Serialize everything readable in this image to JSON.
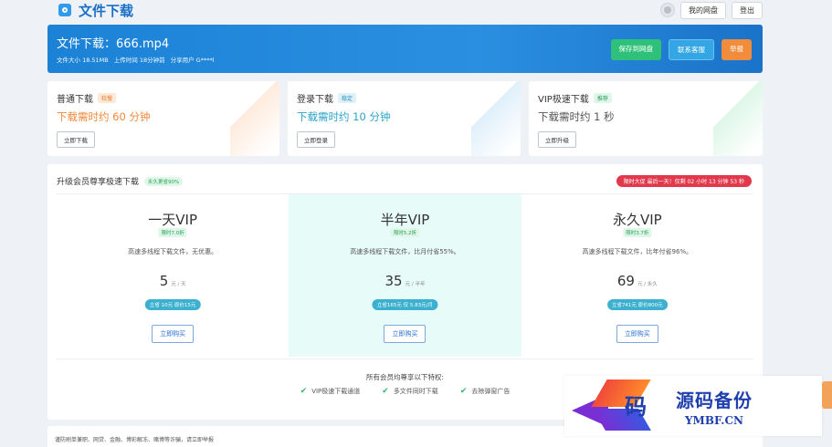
{
  "header": {
    "site_title": "文件下载",
    "my_disk_label": "我的网盘",
    "logout_label": "登出"
  },
  "banner": {
    "title": "文件下载：666.mp4",
    "file_size": "文件大小 18.51MB",
    "upload_time": "上传时间 18分钟前",
    "sharer": "分享用户 G****l",
    "save_label": "保存到网盘",
    "service_label": "联系客服",
    "report_label": "举报"
  },
  "download_options": [
    {
      "title": "普通下载",
      "tag": "较慢",
      "time": "下载需时约 60 分钟",
      "button": "立即下载",
      "color": "#f0883a",
      "tag_bg": "#fde9d6",
      "tag_color": "#e9782a"
    },
    {
      "title": "登录下载",
      "tag": "稳定",
      "time": "下载需时约 10 分钟",
      "button": "立即登录",
      "color": "#2ba3c9",
      "tag_bg": "#dff1f8",
      "tag_color": "#2a8fb8"
    },
    {
      "title": "VIP极速下载",
      "tag": "推荐",
      "time": "下载需时约 1 秒",
      "button": "立即升级",
      "color": "#555555",
      "tag_bg": "#dff7e8",
      "tag_color": "#2a9d5a"
    }
  ],
  "vip": {
    "title": "升级会员尊享极速下载",
    "tag": "永久更省90%",
    "countdown": "限时大促 最后一天！仅剩 02 小时 13 分钟 53 秒",
    "plans": [
      {
        "name": "一天VIP",
        "badge": "限时7.0折",
        "desc": "高速多线程下载文件，无优惠。",
        "price": "5",
        "unit": "元 / 天",
        "save": "立省 10元 原价15元",
        "buy": "立即购买"
      },
      {
        "name": "半年VIP",
        "badge": "限时5.2折",
        "desc": "高速多线程下载文件，比月付省55%。",
        "price": "35",
        "unit": "元 / 半年",
        "save": "立省165元 仅 5.83元/月",
        "buy": "立即购买"
      },
      {
        "name": "永久VIP",
        "badge": "限时3.7折",
        "desc": "高速多线程下载文件，比年付省96%。",
        "price": "69",
        "unit": "元 / 永久",
        "save": "立省741元 原价800元",
        "buy": "立即购买"
      }
    ],
    "privileges_title": "所有会员均尊享以下特权:",
    "privileges": [
      "VIP极速下载通道",
      "多文件同时下载",
      "去除弹窗广告"
    ]
  },
  "footer": {
    "notice": "谨防刷单兼职、网贷、金融、博彩解冻、赌博等诈骗，请立即举报"
  },
  "watermark": {
    "logo_char": "码",
    "cn": "源码备份",
    "en": "YMBF.CN"
  }
}
